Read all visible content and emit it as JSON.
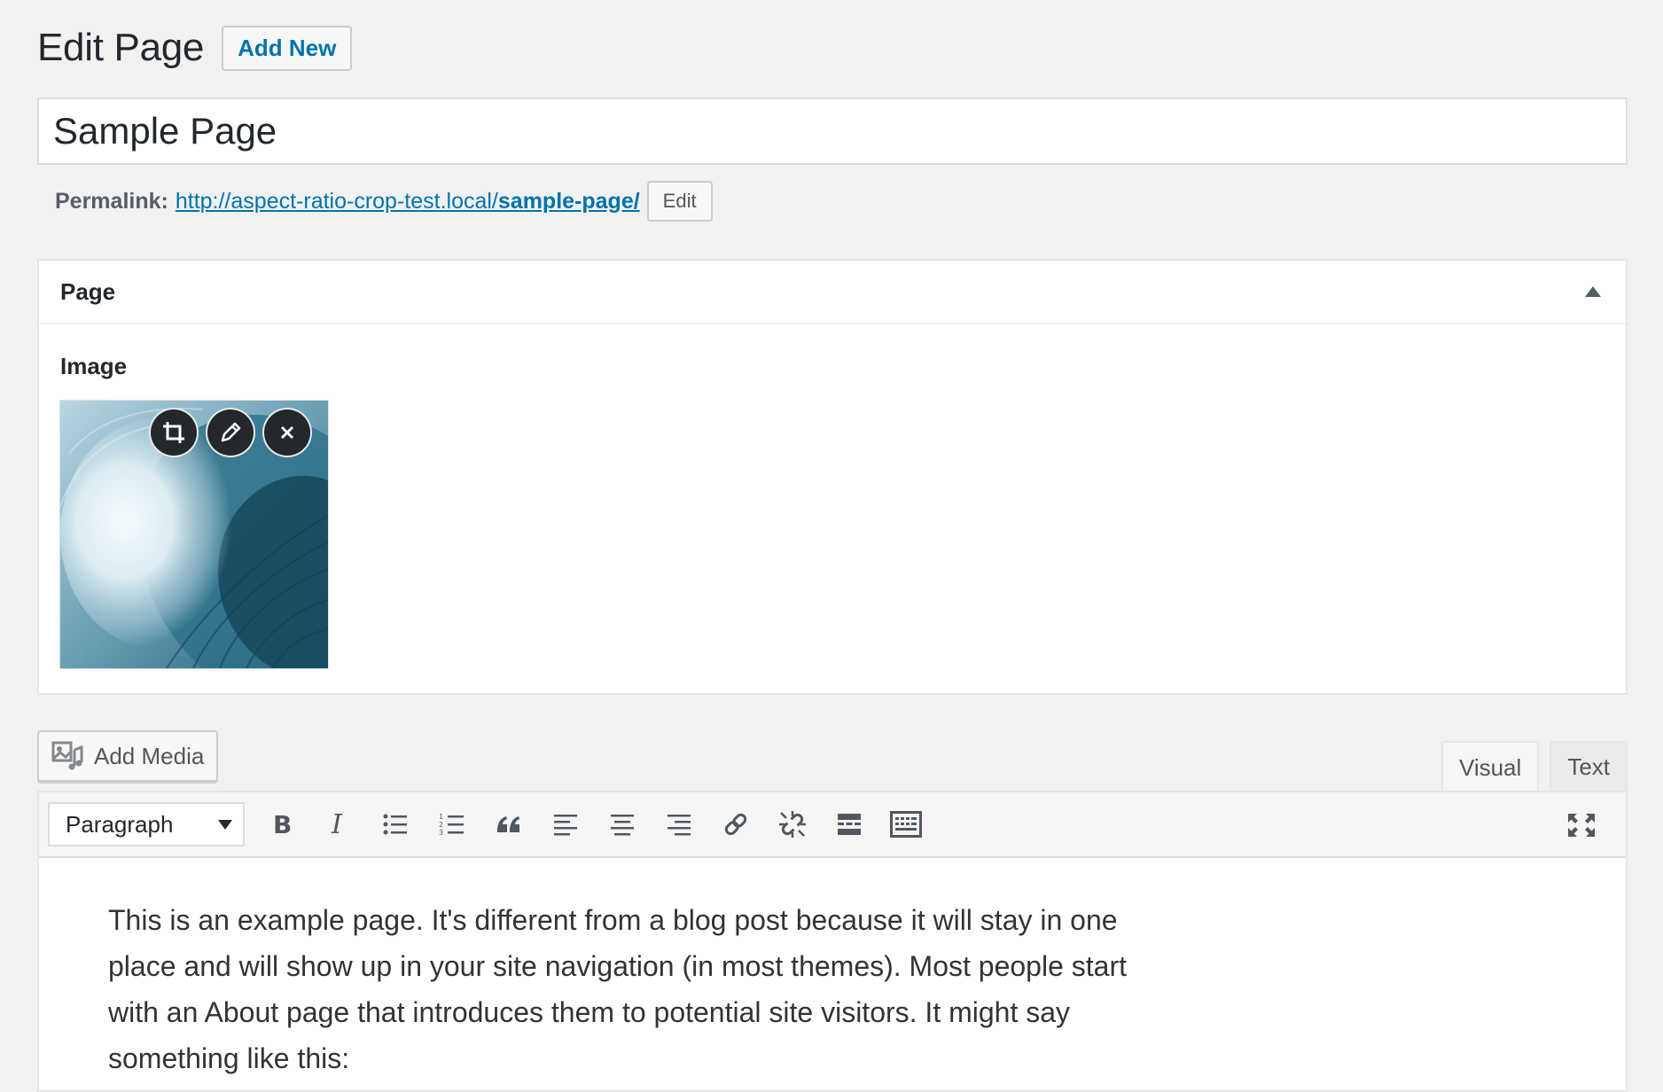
{
  "header": {
    "title": "Edit Page",
    "add_new_label": "Add New"
  },
  "post": {
    "title": "Sample Page"
  },
  "permalink": {
    "label": "Permalink:",
    "url_base": "http://aspect-ratio-crop-test.local/",
    "slug": "sample-page/",
    "edit_label": "Edit"
  },
  "metabox": {
    "title": "Page",
    "field_label": "Image",
    "image_actions": [
      "crop-icon",
      "pencil-icon",
      "close-icon"
    ]
  },
  "editor": {
    "add_media_label": "Add Media",
    "tabs": [
      {
        "label": "Visual",
        "active": true
      },
      {
        "label": "Text",
        "active": false
      }
    ],
    "format_select": "Paragraph",
    "toolbar_icons": [
      "bold-icon",
      "italic-icon",
      "bullet-list-icon",
      "numbered-list-icon",
      "blockquote-icon",
      "align-left-icon",
      "align-center-icon",
      "align-right-icon",
      "link-icon",
      "unlink-icon",
      "read-more-icon",
      "toolbar-toggle-icon",
      "fullscreen-icon"
    ],
    "content": "This is an example page. It's different from a blog post because it will stay in one place and will show up in your site navigation (in most themes). Most people start with an About page that introduces them to potential site visitors. It might say something like this:"
  },
  "colors": {
    "link": "#0073aa",
    "background": "#f1f1f1",
    "text": "#23282d"
  }
}
